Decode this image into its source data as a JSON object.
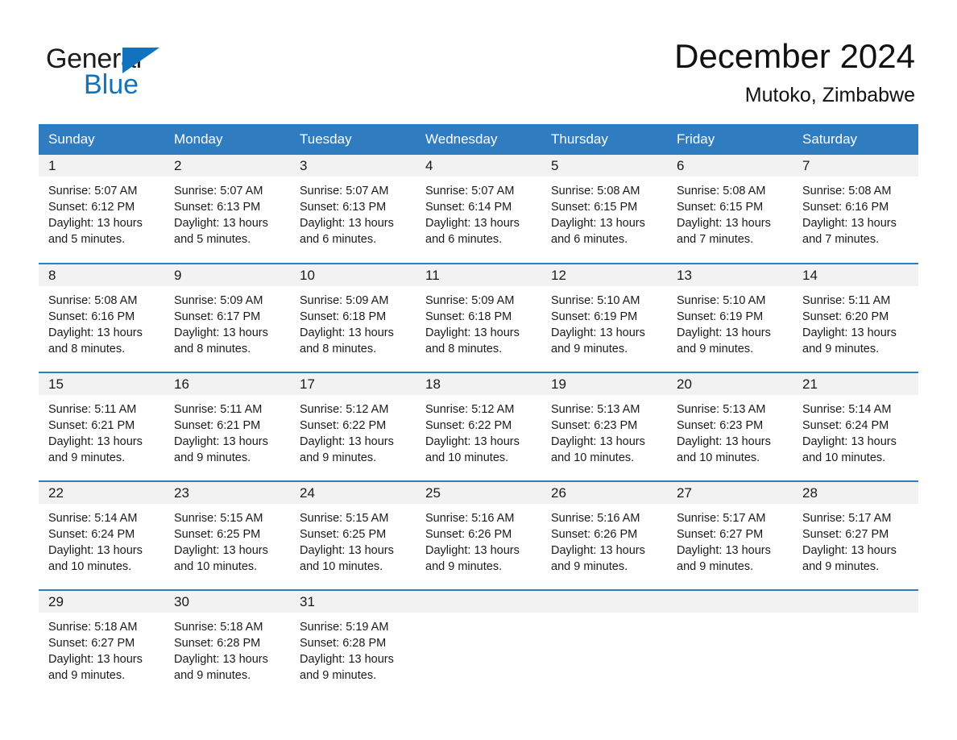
{
  "brand": {
    "name_part1": "General",
    "name_part2": "Blue",
    "triangle_color": "#1173bd",
    "logo_icon": "triangle-logo-icon"
  },
  "header": {
    "title": "December 2024",
    "location": "Mutoko, Zimbabwe"
  },
  "colors": {
    "header_blue": "#2f7cc0",
    "daynum_gray": "#f2f2f2",
    "text": "#1a1a1a",
    "brand_blue": "#1173bd"
  },
  "calendar": {
    "weekday_headers": [
      "Sunday",
      "Monday",
      "Tuesday",
      "Wednesday",
      "Thursday",
      "Friday",
      "Saturday"
    ],
    "weeks": [
      [
        {
          "day": "1",
          "sunrise": "Sunrise: 5:07 AM",
          "sunset": "Sunset: 6:12 PM",
          "daylight_line1": "Daylight: 13 hours",
          "daylight_line2": "and 5 minutes."
        },
        {
          "day": "2",
          "sunrise": "Sunrise: 5:07 AM",
          "sunset": "Sunset: 6:13 PM",
          "daylight_line1": "Daylight: 13 hours",
          "daylight_line2": "and 5 minutes."
        },
        {
          "day": "3",
          "sunrise": "Sunrise: 5:07 AM",
          "sunset": "Sunset: 6:13 PM",
          "daylight_line1": "Daylight: 13 hours",
          "daylight_line2": "and 6 minutes."
        },
        {
          "day": "4",
          "sunrise": "Sunrise: 5:07 AM",
          "sunset": "Sunset: 6:14 PM",
          "daylight_line1": "Daylight: 13 hours",
          "daylight_line2": "and 6 minutes."
        },
        {
          "day": "5",
          "sunrise": "Sunrise: 5:08 AM",
          "sunset": "Sunset: 6:15 PM",
          "daylight_line1": "Daylight: 13 hours",
          "daylight_line2": "and 6 minutes."
        },
        {
          "day": "6",
          "sunrise": "Sunrise: 5:08 AM",
          "sunset": "Sunset: 6:15 PM",
          "daylight_line1": "Daylight: 13 hours",
          "daylight_line2": "and 7 minutes."
        },
        {
          "day": "7",
          "sunrise": "Sunrise: 5:08 AM",
          "sunset": "Sunset: 6:16 PM",
          "daylight_line1": "Daylight: 13 hours",
          "daylight_line2": "and 7 minutes."
        }
      ],
      [
        {
          "day": "8",
          "sunrise": "Sunrise: 5:08 AM",
          "sunset": "Sunset: 6:16 PM",
          "daylight_line1": "Daylight: 13 hours",
          "daylight_line2": "and 8 minutes."
        },
        {
          "day": "9",
          "sunrise": "Sunrise: 5:09 AM",
          "sunset": "Sunset: 6:17 PM",
          "daylight_line1": "Daylight: 13 hours",
          "daylight_line2": "and 8 minutes."
        },
        {
          "day": "10",
          "sunrise": "Sunrise: 5:09 AM",
          "sunset": "Sunset: 6:18 PM",
          "daylight_line1": "Daylight: 13 hours",
          "daylight_line2": "and 8 minutes."
        },
        {
          "day": "11",
          "sunrise": "Sunrise: 5:09 AM",
          "sunset": "Sunset: 6:18 PM",
          "daylight_line1": "Daylight: 13 hours",
          "daylight_line2": "and 8 minutes."
        },
        {
          "day": "12",
          "sunrise": "Sunrise: 5:10 AM",
          "sunset": "Sunset: 6:19 PM",
          "daylight_line1": "Daylight: 13 hours",
          "daylight_line2": "and 9 minutes."
        },
        {
          "day": "13",
          "sunrise": "Sunrise: 5:10 AM",
          "sunset": "Sunset: 6:19 PM",
          "daylight_line1": "Daylight: 13 hours",
          "daylight_line2": "and 9 minutes."
        },
        {
          "day": "14",
          "sunrise": "Sunrise: 5:11 AM",
          "sunset": "Sunset: 6:20 PM",
          "daylight_line1": "Daylight: 13 hours",
          "daylight_line2": "and 9 minutes."
        }
      ],
      [
        {
          "day": "15",
          "sunrise": "Sunrise: 5:11 AM",
          "sunset": "Sunset: 6:21 PM",
          "daylight_line1": "Daylight: 13 hours",
          "daylight_line2": "and 9 minutes."
        },
        {
          "day": "16",
          "sunrise": "Sunrise: 5:11 AM",
          "sunset": "Sunset: 6:21 PM",
          "daylight_line1": "Daylight: 13 hours",
          "daylight_line2": "and 9 minutes."
        },
        {
          "day": "17",
          "sunrise": "Sunrise: 5:12 AM",
          "sunset": "Sunset: 6:22 PM",
          "daylight_line1": "Daylight: 13 hours",
          "daylight_line2": "and 9 minutes."
        },
        {
          "day": "18",
          "sunrise": "Sunrise: 5:12 AM",
          "sunset": "Sunset: 6:22 PM",
          "daylight_line1": "Daylight: 13 hours",
          "daylight_line2": "and 10 minutes."
        },
        {
          "day": "19",
          "sunrise": "Sunrise: 5:13 AM",
          "sunset": "Sunset: 6:23 PM",
          "daylight_line1": "Daylight: 13 hours",
          "daylight_line2": "and 10 minutes."
        },
        {
          "day": "20",
          "sunrise": "Sunrise: 5:13 AM",
          "sunset": "Sunset: 6:23 PM",
          "daylight_line1": "Daylight: 13 hours",
          "daylight_line2": "and 10 minutes."
        },
        {
          "day": "21",
          "sunrise": "Sunrise: 5:14 AM",
          "sunset": "Sunset: 6:24 PM",
          "daylight_line1": "Daylight: 13 hours",
          "daylight_line2": "and 10 minutes."
        }
      ],
      [
        {
          "day": "22",
          "sunrise": "Sunrise: 5:14 AM",
          "sunset": "Sunset: 6:24 PM",
          "daylight_line1": "Daylight: 13 hours",
          "daylight_line2": "and 10 minutes."
        },
        {
          "day": "23",
          "sunrise": "Sunrise: 5:15 AM",
          "sunset": "Sunset: 6:25 PM",
          "daylight_line1": "Daylight: 13 hours",
          "daylight_line2": "and 10 minutes."
        },
        {
          "day": "24",
          "sunrise": "Sunrise: 5:15 AM",
          "sunset": "Sunset: 6:25 PM",
          "daylight_line1": "Daylight: 13 hours",
          "daylight_line2": "and 10 minutes."
        },
        {
          "day": "25",
          "sunrise": "Sunrise: 5:16 AM",
          "sunset": "Sunset: 6:26 PM",
          "daylight_line1": "Daylight: 13 hours",
          "daylight_line2": "and 9 minutes."
        },
        {
          "day": "26",
          "sunrise": "Sunrise: 5:16 AM",
          "sunset": "Sunset: 6:26 PM",
          "daylight_line1": "Daylight: 13 hours",
          "daylight_line2": "and 9 minutes."
        },
        {
          "day": "27",
          "sunrise": "Sunrise: 5:17 AM",
          "sunset": "Sunset: 6:27 PM",
          "daylight_line1": "Daylight: 13 hours",
          "daylight_line2": "and 9 minutes."
        },
        {
          "day": "28",
          "sunrise": "Sunrise: 5:17 AM",
          "sunset": "Sunset: 6:27 PM",
          "daylight_line1": "Daylight: 13 hours",
          "daylight_line2": "and 9 minutes."
        }
      ],
      [
        {
          "day": "29",
          "sunrise": "Sunrise: 5:18 AM",
          "sunset": "Sunset: 6:27 PM",
          "daylight_line1": "Daylight: 13 hours",
          "daylight_line2": "and 9 minutes."
        },
        {
          "day": "30",
          "sunrise": "Sunrise: 5:18 AM",
          "sunset": "Sunset: 6:28 PM",
          "daylight_line1": "Daylight: 13 hours",
          "daylight_line2": "and 9 minutes."
        },
        {
          "day": "31",
          "sunrise": "Sunrise: 5:19 AM",
          "sunset": "Sunset: 6:28 PM",
          "daylight_line1": "Daylight: 13 hours",
          "daylight_line2": "and 9 minutes."
        },
        {
          "day": "",
          "sunrise": "",
          "sunset": "",
          "daylight_line1": "",
          "daylight_line2": ""
        },
        {
          "day": "",
          "sunrise": "",
          "sunset": "",
          "daylight_line1": "",
          "daylight_line2": ""
        },
        {
          "day": "",
          "sunrise": "",
          "sunset": "",
          "daylight_line1": "",
          "daylight_line2": ""
        },
        {
          "day": "",
          "sunrise": "",
          "sunset": "",
          "daylight_line1": "",
          "daylight_line2": ""
        }
      ]
    ]
  }
}
